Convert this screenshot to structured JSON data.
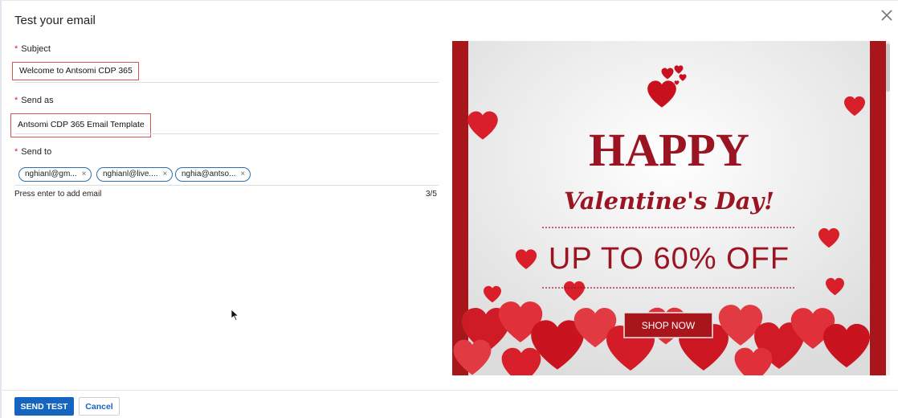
{
  "dialog": {
    "title": "Test your email"
  },
  "fields": {
    "required_mark": "*",
    "subject_label": "Subject",
    "subject_value": "Welcome to Antsomi CDP 365",
    "send_as_label": "Send as",
    "send_as_value": "Antsomi CDP 365 Email Template",
    "send_to_label": "Send to",
    "recipients": [
      "nghianl@gm...",
      "nghianl@live....",
      "nghia@antso..."
    ],
    "chip_remove": "×",
    "hint": "Press enter to add email",
    "count": "3/5"
  },
  "preview": {
    "heading": "HAPPY",
    "subheading": "Valentine's Day!",
    "offer": "UP TO 60% OFF",
    "cta": "SHOP NOW",
    "colors": {
      "band": "#a8161c",
      "heart": "#d81f2a",
      "text": "#9a1422"
    }
  },
  "actions": {
    "send_label": "SEND TEST",
    "cancel_label": "Cancel"
  },
  "icons": {
    "close": "close-icon",
    "cursor": "mouse-pointer-icon"
  }
}
